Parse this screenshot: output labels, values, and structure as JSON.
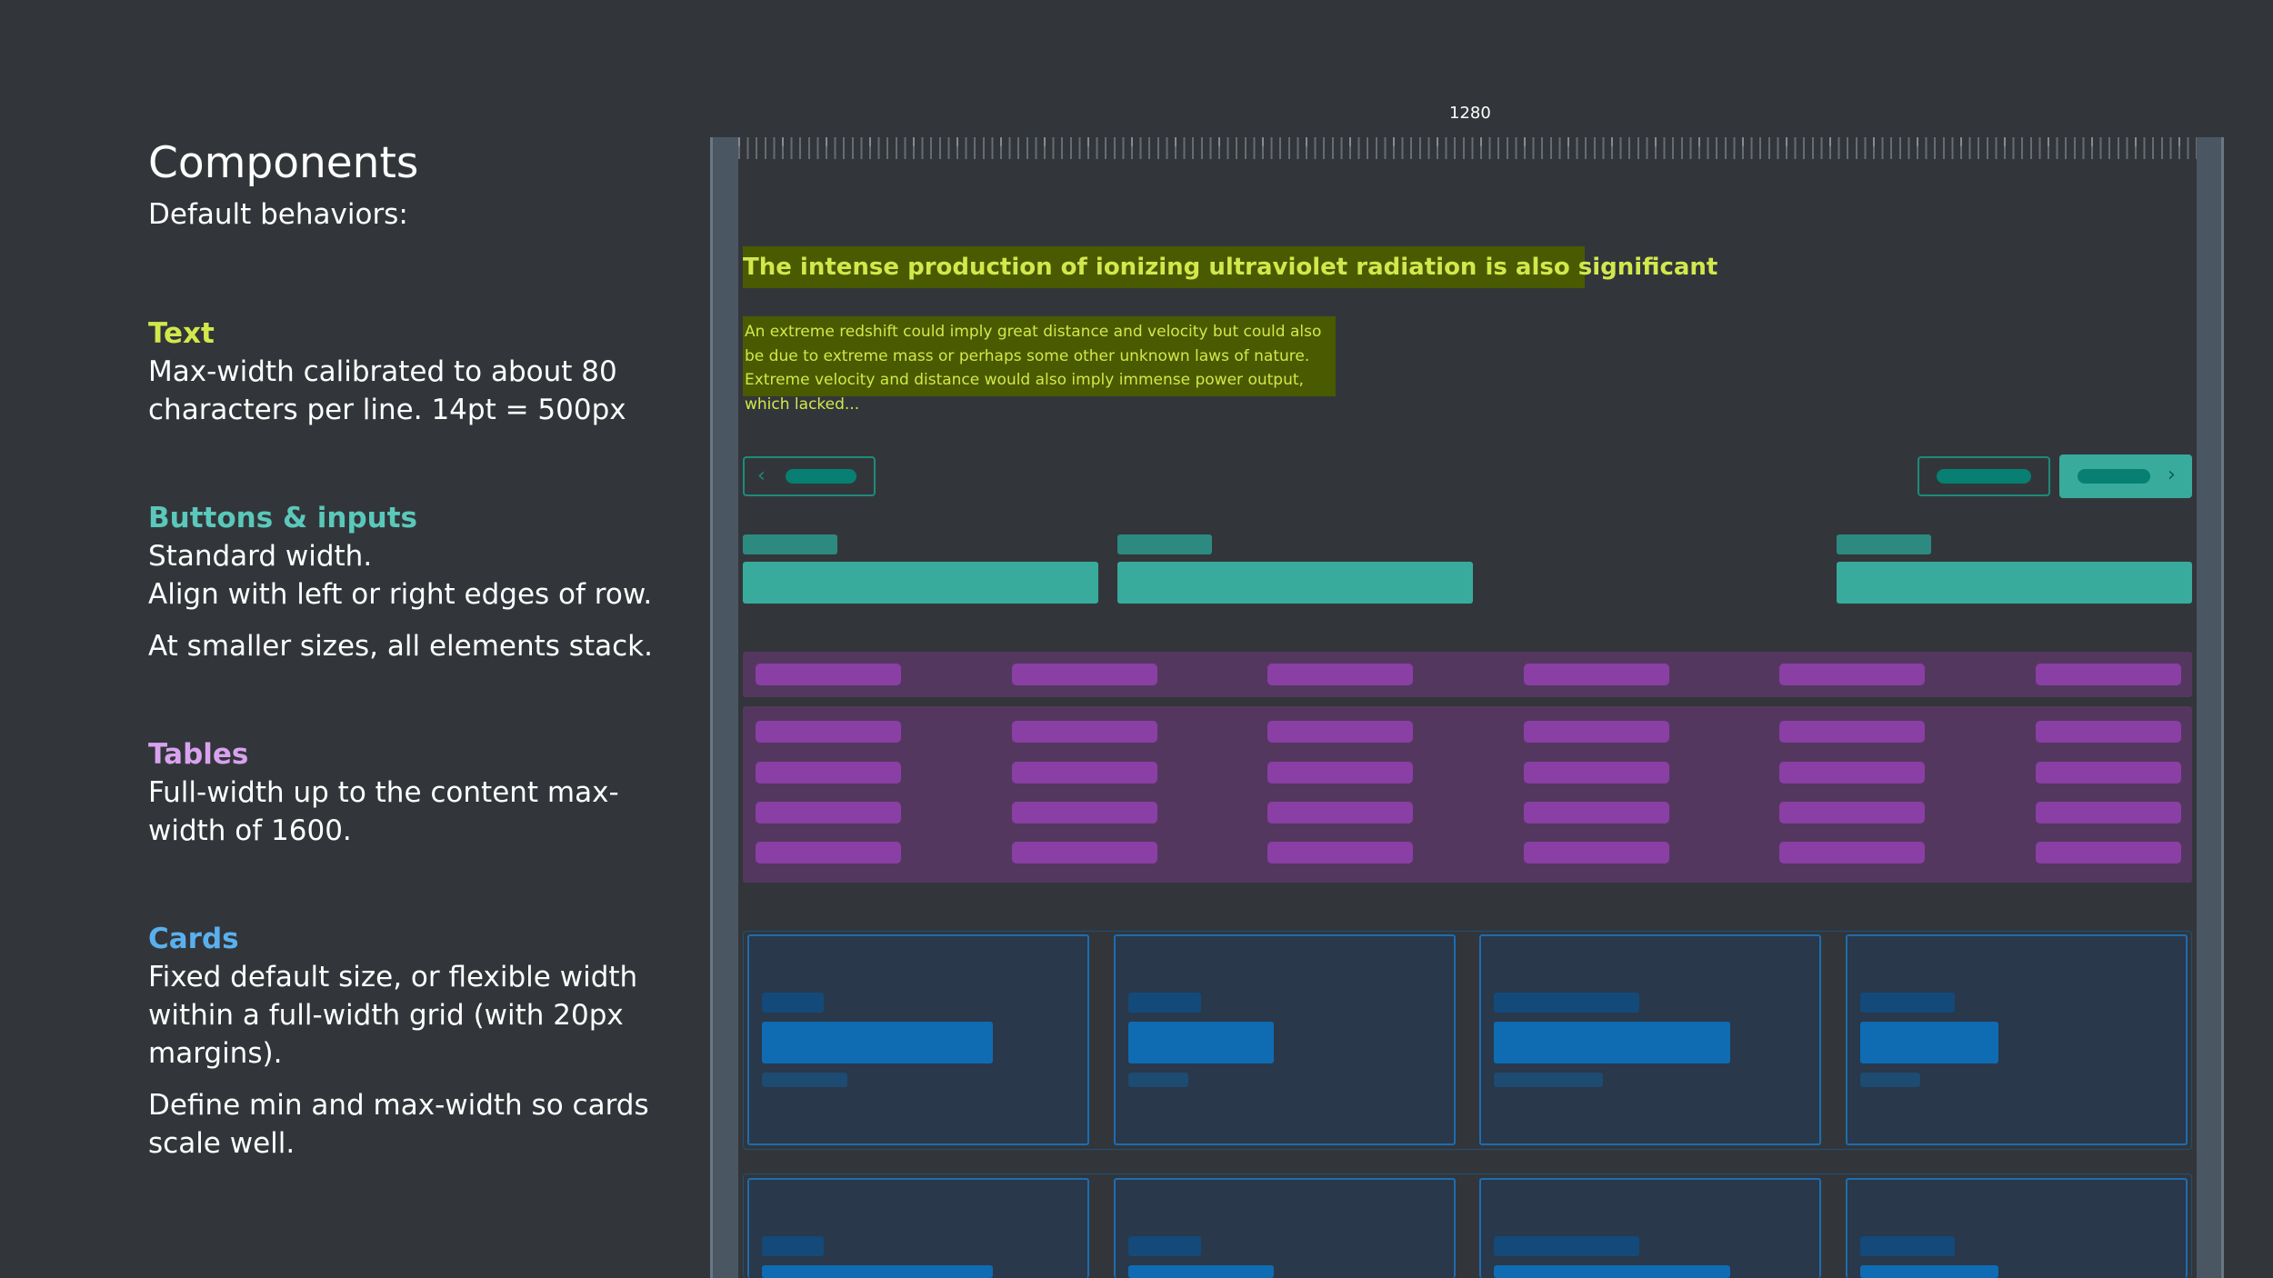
{
  "sidebar": {
    "title": "Components",
    "subtitle": "Default behaviors:",
    "sections": [
      {
        "heading": "Text",
        "color": "#d2e84b",
        "paragraphs": [
          "Max-width calibrated to about 80 characters per line. 14pt = 500px"
        ]
      },
      {
        "heading": "Buttons & inputs",
        "color": "#5ac8bb",
        "paragraphs": [
          "Standard width.\nAlign with left or right edges of row.",
          "At smaller sizes, all elements stack."
        ]
      },
      {
        "heading": "Tables",
        "color": "#d8a2ee",
        "paragraphs": [
          "Full-width up to the content max-width of 1600."
        ]
      },
      {
        "heading": "Cards",
        "color": "#5ab0ee",
        "paragraphs": [
          "Fixed default size, or flexible width within a full-width grid (with 20px margins).",
          "Define min and max-width so cards scale well."
        ]
      }
    ]
  },
  "preview": {
    "width_label": "1280",
    "text_heading": "The intense production of ionizing ultraviolet radiation is also significant",
    "text_paragraph": "An extreme redshift could imply great distance and velocity but could also be due to extreme mass or perhaps some other unknown laws of nature. Extreme velocity and distance would also imply immense power output, which lacked...",
    "prev_icon": "chevron-left-icon",
    "next_icon": "chevron-right-icon",
    "colors": {
      "text_bg": "#4a5a00",
      "text_fg": "#d2e84b",
      "button": "#38ab9d",
      "table": "#54375f",
      "table_cell": "#8a3fa5",
      "card": "#29384a",
      "card_accent": "#0f6cb3"
    }
  }
}
